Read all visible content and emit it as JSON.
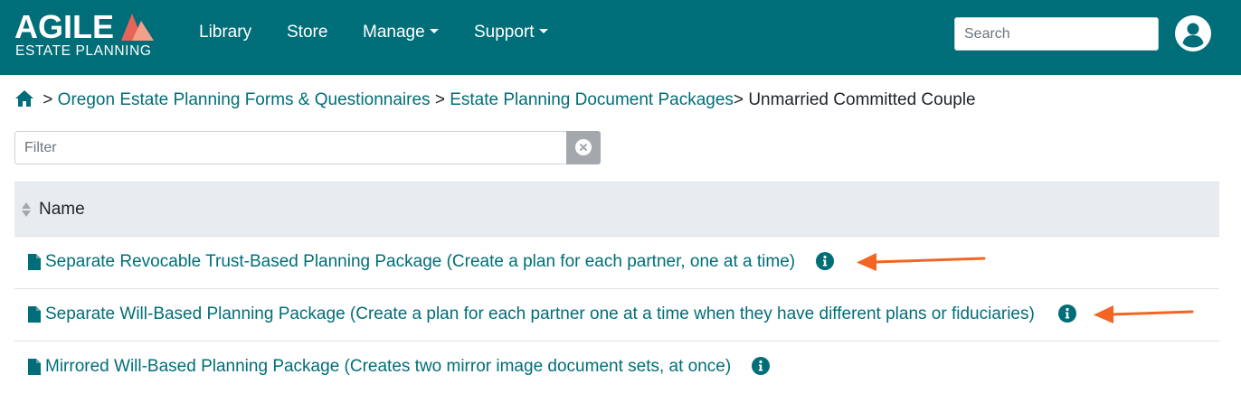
{
  "brand": {
    "logo_text": "AGILE",
    "logo_subtext": "ESTATE PLANNING",
    "colors": {
      "primary": "#006e78",
      "mark_red": "#e8645a",
      "mark_salmon": "#f2a08a",
      "annotation_arrow": "#f26522"
    }
  },
  "nav": {
    "items": [
      {
        "label": "Library"
      },
      {
        "label": "Store"
      },
      {
        "label": "Manage"
      },
      {
        "label": "Support"
      }
    ],
    "search_placeholder": "Search",
    "user_icon": "user-circle-icon"
  },
  "breadcrumb": {
    "home_icon": "home-icon",
    "sep1": ">",
    "item1": "Oregon Estate Planning Forms & Questionnaires",
    "sep2": ">",
    "item2": "Estate Planning Document Packages",
    "sep3": ">",
    "current": "Unmarried Committed Couple"
  },
  "filter": {
    "placeholder": "Filter",
    "clear_icon": "clear-circle-icon"
  },
  "table": {
    "header": "Name",
    "rows": [
      {
        "label": "Separate Revocable Trust-Based Planning Package (Create a plan for each partner, one at a time)",
        "icon": "document-icon",
        "info_icon": "info-icon",
        "highlighted": true
      },
      {
        "label": "Separate Will-Based Planning Package (Create a plan for each partner one at a time when they have different plans or fiduciaries)",
        "icon": "document-icon",
        "info_icon": "info-icon",
        "highlighted": true
      },
      {
        "label": "Mirrored Will-Based Planning Package (Creates two mirror image document sets, at once)",
        "icon": "document-icon",
        "info_icon": "info-icon",
        "highlighted": false
      }
    ]
  }
}
